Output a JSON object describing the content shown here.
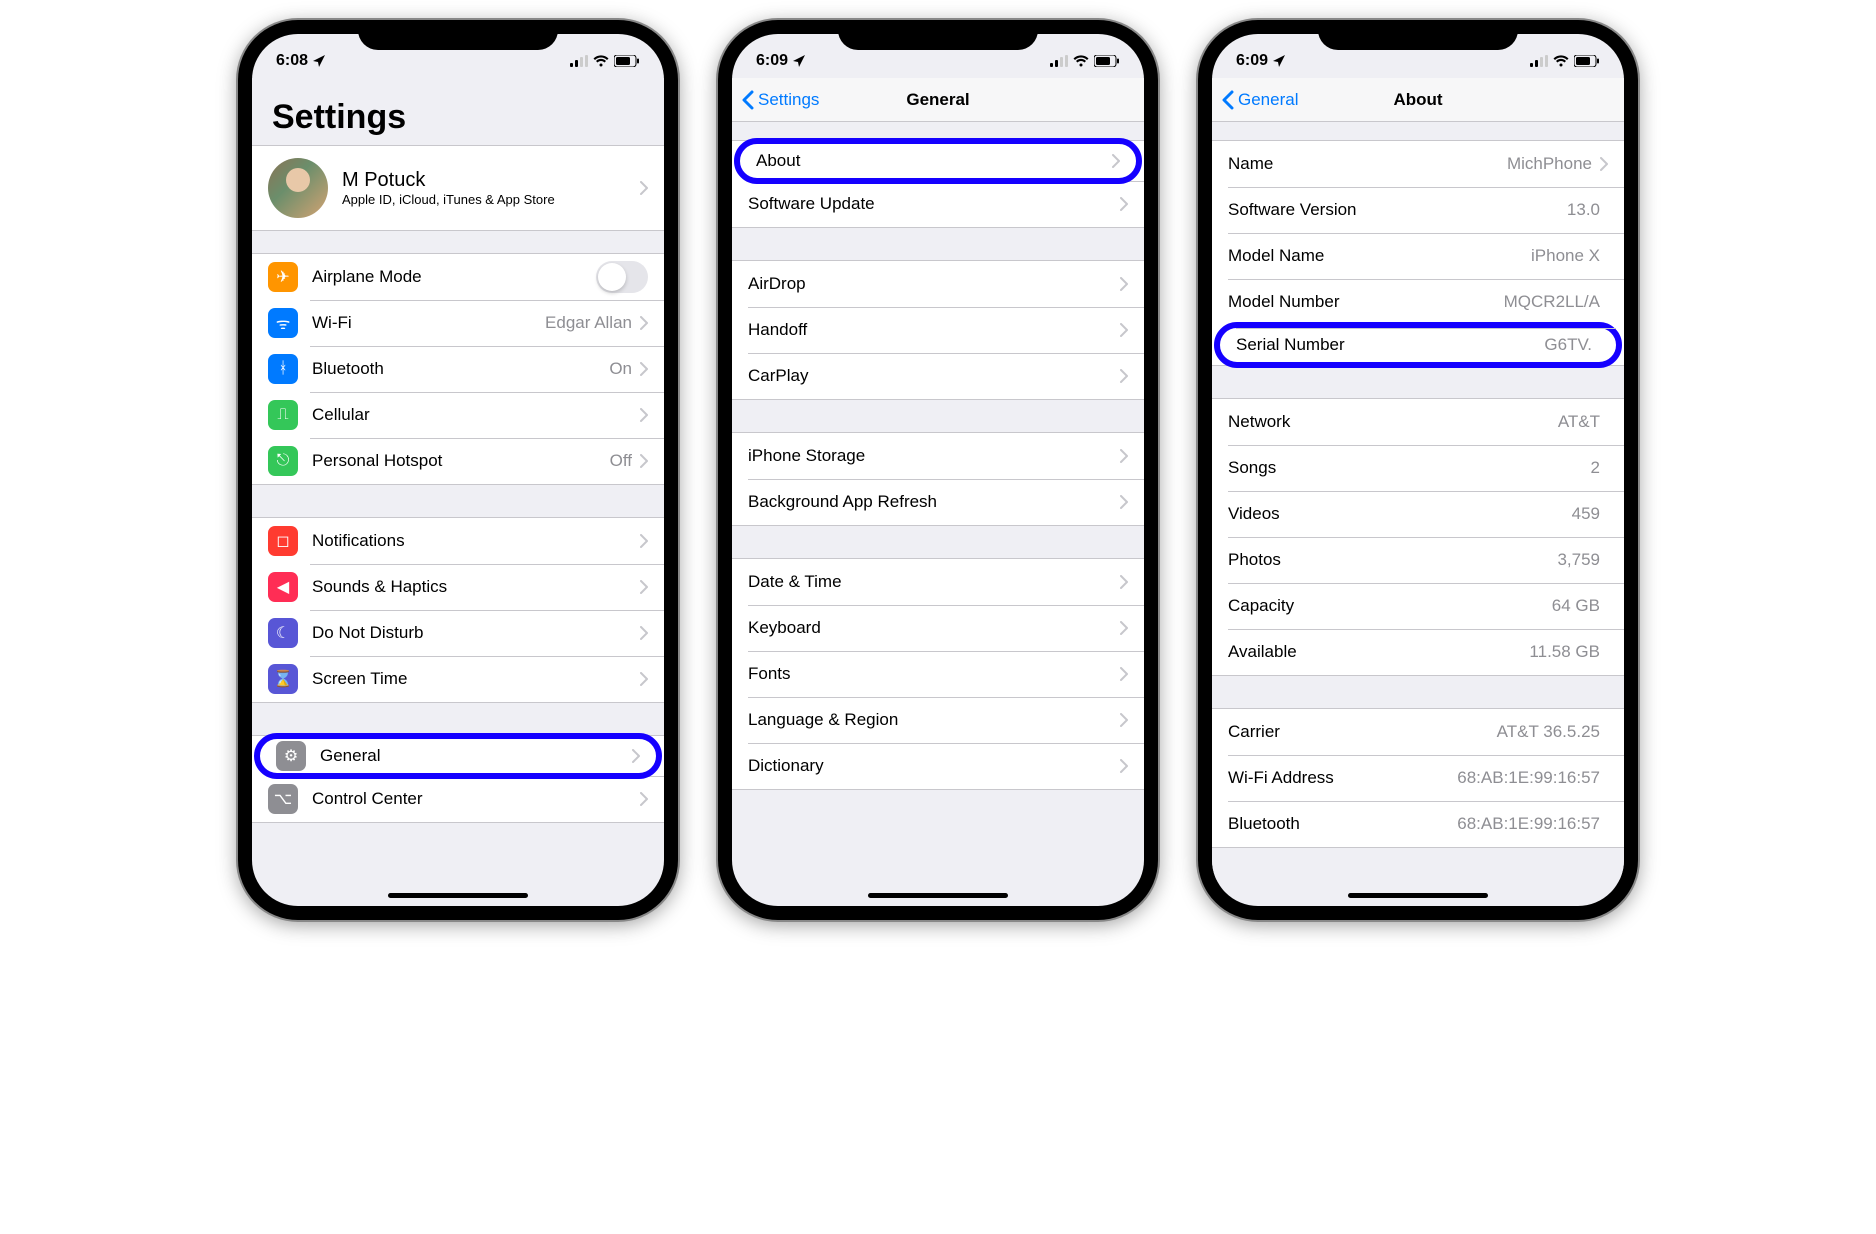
{
  "phones": [
    {
      "status": {
        "time": "6:08",
        "location_icon": true
      },
      "page_type": "settings_root",
      "title": "Settings",
      "apple_id": {
        "name": "M Potuck",
        "sub": "Apple ID, iCloud, iTunes & App Store"
      },
      "groups": [
        {
          "rows": [
            {
              "icon": "airplane",
              "icon_color": "#ff9500",
              "label": "Airplane Mode",
              "control": "toggle"
            },
            {
              "icon": "wifi",
              "icon_color": "#007aff",
              "label": "Wi-Fi",
              "value": "Edgar Allan",
              "chevron": true
            },
            {
              "icon": "bluetooth",
              "icon_color": "#007aff",
              "label": "Bluetooth",
              "value": "On",
              "chevron": true
            },
            {
              "icon": "cellular",
              "icon_color": "#34c759",
              "label": "Cellular",
              "chevron": true
            },
            {
              "icon": "hotspot",
              "icon_color": "#34c759",
              "label": "Personal Hotspot",
              "value": "Off",
              "chevron": true
            }
          ]
        },
        {
          "rows": [
            {
              "icon": "notifications",
              "icon_color": "#ff3b30",
              "label": "Notifications",
              "chevron": true
            },
            {
              "icon": "sounds",
              "icon_color": "#ff2d55",
              "label": "Sounds & Haptics",
              "chevron": true
            },
            {
              "icon": "dnd",
              "icon_color": "#5856d6",
              "label": "Do Not Disturb",
              "chevron": true
            },
            {
              "icon": "screentime",
              "icon_color": "#5856d6",
              "label": "Screen Time",
              "chevron": true
            }
          ]
        },
        {
          "rows": [
            {
              "icon": "general",
              "icon_color": "#8e8e93",
              "label": "General",
              "chevron": true,
              "highlight": true
            },
            {
              "icon": "control",
              "icon_color": "#8e8e93",
              "label": "Control Center",
              "chevron": true
            }
          ]
        }
      ]
    },
    {
      "status": {
        "time": "6:09",
        "location_icon": true
      },
      "page_type": "nav",
      "back_label": "Settings",
      "nav_title": "General",
      "groups": [
        {
          "rows": [
            {
              "label": "About",
              "chevron": true,
              "highlight": true
            },
            {
              "label": "Software Update",
              "chevron": true
            }
          ]
        },
        {
          "rows": [
            {
              "label": "AirDrop",
              "chevron": true
            },
            {
              "label": "Handoff",
              "chevron": true
            },
            {
              "label": "CarPlay",
              "chevron": true
            }
          ]
        },
        {
          "rows": [
            {
              "label": "iPhone Storage",
              "chevron": true
            },
            {
              "label": "Background App Refresh",
              "chevron": true
            }
          ]
        },
        {
          "rows": [
            {
              "label": "Date & Time",
              "chevron": true
            },
            {
              "label": "Keyboard",
              "chevron": true
            },
            {
              "label": "Fonts",
              "chevron": true
            },
            {
              "label": "Language & Region",
              "chevron": true
            },
            {
              "label": "Dictionary",
              "chevron": true
            }
          ]
        }
      ]
    },
    {
      "status": {
        "time": "6:09",
        "location_icon": true
      },
      "page_type": "nav",
      "back_label": "General",
      "nav_title": "About",
      "groups": [
        {
          "rows": [
            {
              "label": "Name",
              "value": "MichPhone",
              "chevron": true
            },
            {
              "label": "Software Version",
              "value": "13.0"
            },
            {
              "label": "Model Name",
              "value": "iPhone X"
            },
            {
              "label": "Model Number",
              "value": "MQCR2LL/A"
            },
            {
              "label": "Serial Number",
              "value": "G6TV.",
              "highlight": true
            }
          ]
        },
        {
          "rows": [
            {
              "label": "Network",
              "value": "AT&T"
            },
            {
              "label": "Songs",
              "value": "2"
            },
            {
              "label": "Videos",
              "value": "459"
            },
            {
              "label": "Photos",
              "value": "3,759"
            },
            {
              "label": "Capacity",
              "value": "64 GB"
            },
            {
              "label": "Available",
              "value": "11.58 GB"
            }
          ]
        },
        {
          "rows": [
            {
              "label": "Carrier",
              "value": "AT&T 36.5.25"
            },
            {
              "label": "Wi-Fi Address",
              "value": "68:AB:1E:99:16:57"
            },
            {
              "label": "Bluetooth",
              "value": "68:AB:1E:99:16:57"
            }
          ]
        }
      ]
    }
  ]
}
